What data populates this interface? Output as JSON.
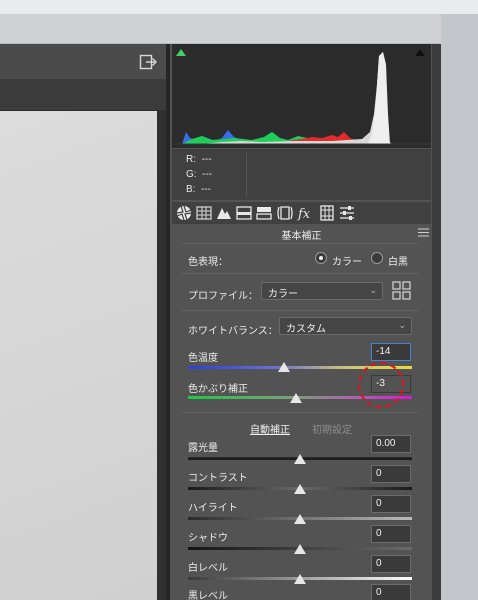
{
  "histogram": {
    "rgb_readout": [
      {
        "channel": "R:",
        "value": "---"
      },
      {
        "channel": "G:",
        "value": "---"
      },
      {
        "channel": "B:",
        "value": "---"
      }
    ]
  },
  "toolbar_tabs": [
    {
      "icon": "aperture-icon"
    },
    {
      "icon": "tone-curve-grid-icon"
    },
    {
      "icon": "detail-triangle-icon"
    },
    {
      "icon": "hsl-icon"
    },
    {
      "icon": "split-toning-icon"
    },
    {
      "icon": "lens-correction-icon"
    },
    {
      "icon": "fx-icon"
    },
    {
      "icon": "calibration-icon"
    },
    {
      "icon": "presets-sliders-icon"
    }
  ],
  "panel": {
    "title": "基本補正",
    "treatment": {
      "label": "色表現：",
      "option_color": "カラー",
      "option_bw": "白黒",
      "selected": "カラー"
    },
    "profile": {
      "label": "プロファイル：",
      "value": "カラー"
    },
    "white_balance": {
      "label": "ホワイトバランス：",
      "value": "カスタム"
    },
    "temperature": {
      "label": "色温度",
      "value": "-14",
      "position": 0.45
    },
    "tint": {
      "label": "色かぶり補正",
      "value": "-3",
      "position": 0.48
    },
    "auto_label": "自動補正",
    "default_label": "初期設定",
    "sliders": [
      {
        "label": "露光量",
        "value": "0.00",
        "position": 0.5
      },
      {
        "label": "コントラスト",
        "value": "0",
        "position": 0.5
      },
      {
        "label": "ハイライト",
        "value": "0",
        "position": 0.5
      },
      {
        "label": "シャドウ",
        "value": "0",
        "position": 0.5
      },
      {
        "label": "白レベル",
        "value": "0",
        "position": 0.5
      },
      {
        "label": "黒レベル",
        "value": "0",
        "position": 0.5
      }
    ]
  },
  "colors": {
    "panel_bg": "#535353",
    "accent_blue": "#3f86d6",
    "annotation_red": "#d8141e"
  }
}
